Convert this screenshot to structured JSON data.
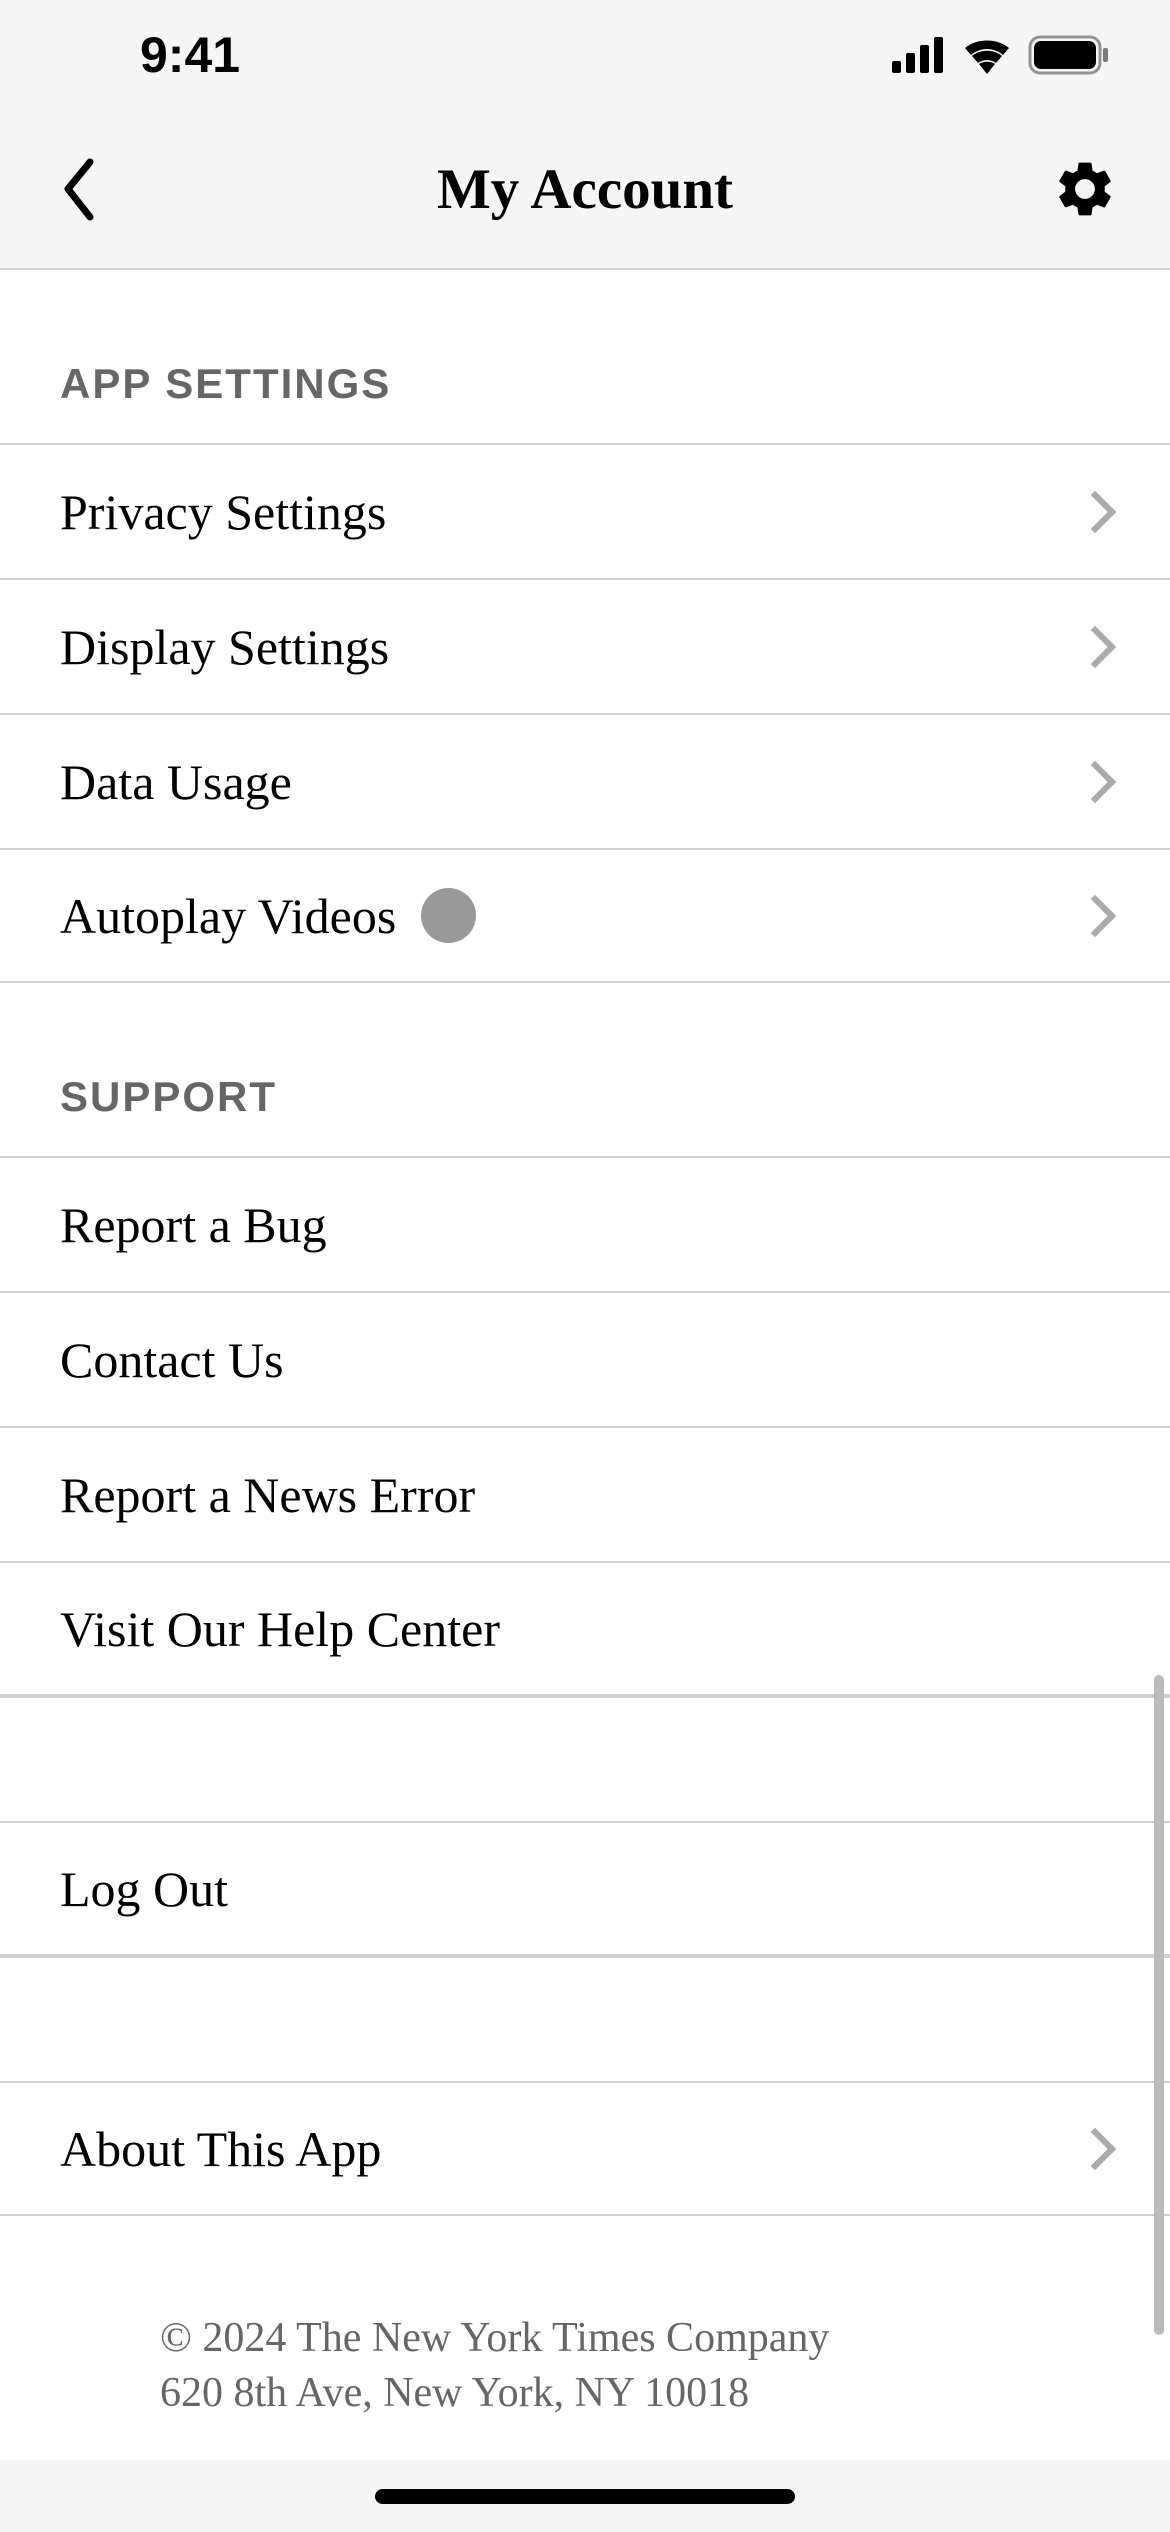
{
  "status": {
    "time": "9:41"
  },
  "header": {
    "title": "My Account"
  },
  "sections": {
    "appSettings": {
      "header": "APP SETTINGS",
      "items": {
        "privacy": {
          "label": "Privacy Settings"
        },
        "display": {
          "label": "Display Settings"
        },
        "dataUsage": {
          "label": "Data Usage"
        },
        "autoplay": {
          "label": "Autoplay Videos"
        }
      }
    },
    "support": {
      "header": "SUPPORT",
      "items": {
        "reportBug": {
          "label": "Report a Bug"
        },
        "contactUs": {
          "label": "Contact Us"
        },
        "reportNewsError": {
          "label": "Report a News Error"
        },
        "helpCenter": {
          "label": "Visit Our Help Center"
        }
      }
    },
    "logout": {
      "label": "Log Out"
    },
    "about": {
      "label": "About This App"
    }
  },
  "footer": {
    "copyright": "© 2024 The New York Times Company",
    "address": "620 8th Ave, New York, NY 10018"
  }
}
